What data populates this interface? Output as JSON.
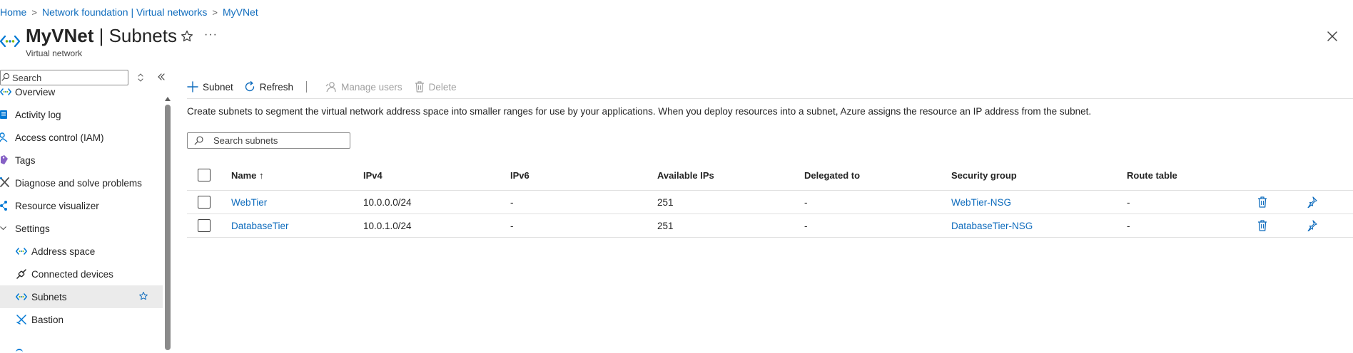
{
  "breadcrumb": {
    "items": [
      "Home",
      "Network foundation | Virtual networks",
      "MyVNet"
    ],
    "separator": ">"
  },
  "header": {
    "title_main": "MyVNet",
    "title_sep": " | ",
    "title_section": "Subnets",
    "subtitle": "Virtual network",
    "more_label": "···"
  },
  "sidebar": {
    "search_placeholder": "Search",
    "items": [
      {
        "label": "Overview",
        "icon": "vnet-icon"
      },
      {
        "label": "Activity log",
        "icon": "activity-log-icon"
      },
      {
        "label": "Access control (IAM)",
        "icon": "iam-icon"
      },
      {
        "label": "Tags",
        "icon": "tag-icon"
      },
      {
        "label": "Diagnose and solve problems",
        "icon": "wrench-icon"
      },
      {
        "label": "Resource visualizer",
        "icon": "visualizer-icon"
      },
      {
        "label": "Settings",
        "icon": "chevron-down-icon"
      },
      {
        "label": "Address space",
        "icon": "vnet-icon"
      },
      {
        "label": "Connected devices",
        "icon": "plug-icon"
      },
      {
        "label": "Subnets",
        "icon": "vnet-icon",
        "selected": true
      },
      {
        "label": "Bastion",
        "icon": "bastion-icon"
      }
    ]
  },
  "toolbar": {
    "add_subnet_label": "Subnet",
    "refresh_label": "Refresh",
    "manage_users_label": "Manage users",
    "delete_label": "Delete"
  },
  "main": {
    "description": "Create subnets to segment the virtual network address space into smaller ranges for use by your applications. When you deploy resources into a subnet, Azure assigns the resource an IP address from the subnet.",
    "search_placeholder": "Search subnets"
  },
  "table": {
    "columns": [
      "Name ↑",
      "IPv4",
      "IPv6",
      "Available IPs",
      "Delegated to",
      "Security group",
      "Route table"
    ],
    "rows": [
      [
        "WebTier",
        "10.0.0.0/24",
        "-",
        "251",
        "-",
        "WebTier-NSG",
        "-"
      ],
      [
        "DatabaseTier",
        "10.0.1.0/24",
        "-",
        "251",
        "-",
        "DatabaseTier-NSG",
        "-"
      ]
    ]
  },
  "colors": {
    "accent": "#0f6cbd",
    "icon_blue": "#0078d4",
    "selected_bg": "#ebebeb",
    "disabled_text": "#a0a0a0"
  }
}
